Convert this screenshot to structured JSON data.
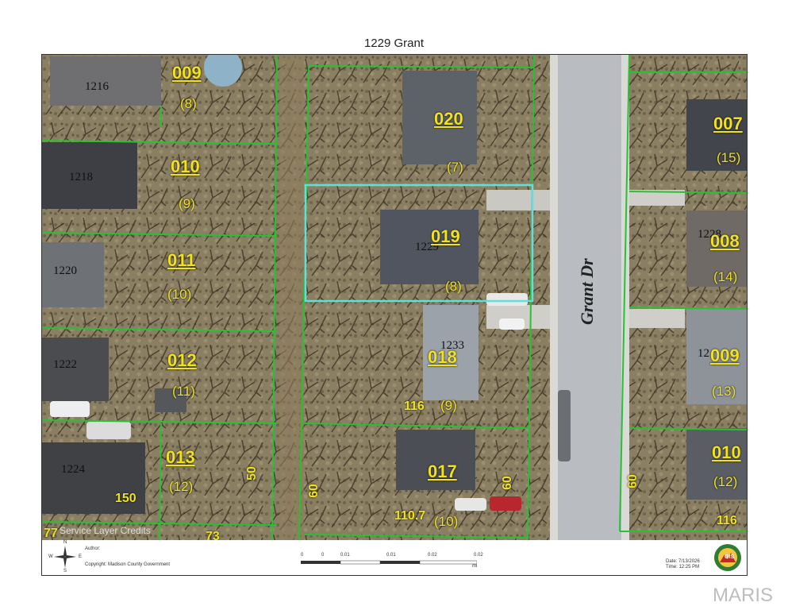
{
  "title": "1229 Grant",
  "street_name": "Grant Dr",
  "parcels": [
    {
      "id": "009",
      "num": "(8)"
    },
    {
      "id": "010",
      "num": "(9)"
    },
    {
      "id": "011",
      "num": "(10)"
    },
    {
      "id": "012",
      "num": "(11)"
    },
    {
      "id": "013",
      "num": "(12)"
    },
    {
      "id": "020",
      "num": "(7)"
    },
    {
      "id": "019",
      "num": "(8)"
    },
    {
      "id": "018",
      "num": "(9)"
    },
    {
      "id": "017",
      "num": "(10)"
    },
    {
      "id": "007",
      "num": "(15)"
    },
    {
      "id": "008",
      "num": "(14)"
    },
    {
      "id": "009",
      "num": "(13)"
    },
    {
      "id": "010",
      "num": "(12)"
    }
  ],
  "addresses": [
    "1216",
    "1218",
    "1220",
    "1222",
    "1224",
    "1229",
    "1233",
    "1228",
    "12"
  ],
  "dimensions": [
    "116",
    "60",
    "60",
    "50",
    "150",
    "110.7",
    "60",
    "73",
    "116",
    "77"
  ],
  "credits": "Service Layer Credits",
  "footer": {
    "author_label": "Author:",
    "copyright": "Copyright: Madison County Government",
    "date": "Date: 7/13/2026",
    "time": "Time: 12:25 PM",
    "scale_ticks": [
      "0",
      "0",
      "0.01",
      "0.01",
      "0.02",
      "0.02"
    ],
    "scale_unit": "mi",
    "compass": {
      "n": "N",
      "s": "S",
      "e": "E",
      "w": "W"
    },
    "seal_text": "GIS"
  },
  "watermark": "MARIS",
  "colors": {
    "parcel_line": "#27c234",
    "subject_parcel": "#5fe0d8",
    "label": "#f2e21c"
  }
}
